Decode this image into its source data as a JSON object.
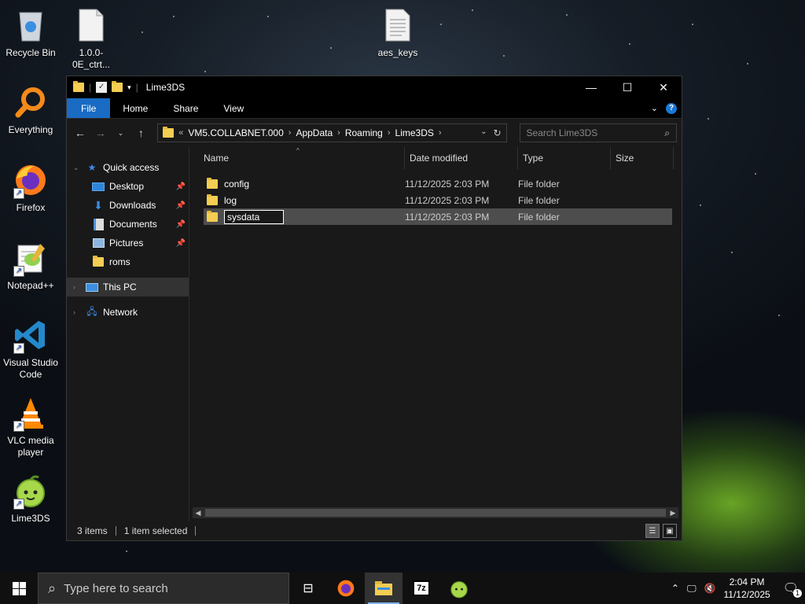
{
  "desktop": {
    "icons": [
      {
        "label": "Recycle Bin",
        "icon": "recycle-bin-icon"
      },
      {
        "label": "1.0.0-0E_ctrt...",
        "icon": "file-icon"
      },
      {
        "label": "aes_keys",
        "icon": "text-file-icon"
      },
      {
        "label": "Everything",
        "icon": "everything-icon"
      },
      {
        "label": "Firefox",
        "icon": "firefox-icon"
      },
      {
        "label": "Notepad++",
        "icon": "notepadpp-icon"
      },
      {
        "label": "Visual Studio Code",
        "icon": "vscode-icon"
      },
      {
        "label": "VLC media player",
        "icon": "vlc-icon"
      },
      {
        "label": "Lime3DS",
        "icon": "lime3ds-icon"
      }
    ]
  },
  "window": {
    "title": "Lime3DS",
    "ribbon_tabs": [
      "File",
      "Home",
      "Share",
      "View"
    ],
    "address": {
      "overflow": "«",
      "crumbs": [
        "VM5.COLLABNET.000",
        "AppData",
        "Roaming",
        "Lime3DS"
      ]
    },
    "search_placeholder": "Search Lime3DS",
    "nav": {
      "quick_access": "Quick access",
      "items": [
        {
          "label": "Desktop",
          "icon": "desktop-icon",
          "pinned": true
        },
        {
          "label": "Downloads",
          "icon": "downloads-icon",
          "pinned": true
        },
        {
          "label": "Documents",
          "icon": "documents-icon",
          "pinned": true
        },
        {
          "label": "Pictures",
          "icon": "pictures-icon",
          "pinned": true
        },
        {
          "label": "roms",
          "icon": "folder-icon",
          "pinned": false
        }
      ],
      "this_pc": "This PC",
      "network": "Network"
    },
    "columns": [
      "Name",
      "Date modified",
      "Type",
      "Size"
    ],
    "files": [
      {
        "name": "config",
        "date": "11/12/2025 2:03 PM",
        "type": "File folder"
      },
      {
        "name": "log",
        "date": "11/12/2025 2:03 PM",
        "type": "File folder"
      },
      {
        "name": "sysdata",
        "date": "11/12/2025 2:03 PM",
        "type": "File folder",
        "selected": true,
        "renaming": true
      }
    ],
    "status": {
      "count": "3 items",
      "selected": "1 item selected"
    }
  },
  "taskbar": {
    "search_placeholder": "Type here to search",
    "time": "2:04 PM",
    "date": "11/12/2025",
    "notification_count": "1"
  },
  "colors": {
    "accent": "#1a6bc4",
    "folder": "#f4cd52",
    "window_bg": "#191919",
    "selected_row": "#4d4d4d"
  }
}
